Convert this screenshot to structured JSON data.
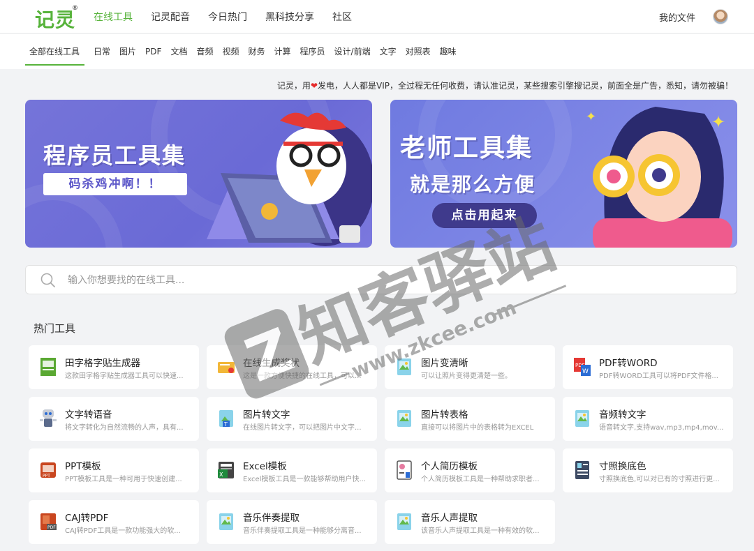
{
  "header": {
    "logo": "记灵",
    "logo_mark": "®",
    "nav": [
      {
        "label": "在线工具",
        "active": true
      },
      {
        "label": "记灵配音",
        "active": false
      },
      {
        "label": "今日热门",
        "active": false
      },
      {
        "label": "黑科技分享",
        "active": false
      },
      {
        "label": "社区",
        "active": false
      }
    ],
    "my_files": "我的文件"
  },
  "categories": [
    "全部在线工具",
    "日常",
    "图片",
    "PDF",
    "文档",
    "音频",
    "视频",
    "财务",
    "计算",
    "程序员",
    "设计/前端",
    "文字",
    "对照表",
    "趣味"
  ],
  "notice": {
    "before": "记灵，用",
    "heart": "❤",
    "after": "发电，人人都是VIP，全过程无任何收费，请认准记灵，某些搜索引擎搜记灵，前面全是广告，悉知，请勿被骗！"
  },
  "banners": {
    "left": {
      "title": "程序员工具集",
      "pill": "码杀鸡冲啊！！"
    },
    "right": {
      "title": "老师工具集",
      "subtitle": "就是那么方便",
      "pill": "点击用起来"
    }
  },
  "search": {
    "placeholder": "输入你想要找的在线工具..."
  },
  "section_title": "热门工具",
  "tools": [
    {
      "title": "田字格字贴生成器",
      "desc": "这款田字格字贴生成器工具可以快速...",
      "icon": "jiling-logo-icon"
    },
    {
      "title": "在线生成奖状",
      "desc": "这是一款方便快捷的在线工具，可以...",
      "icon": "certificate-icon"
    },
    {
      "title": "图片变清晰",
      "desc": "可以让照片变得更清楚一些。",
      "icon": "image-icon"
    },
    {
      "title": "PDF转WORD",
      "desc": "PDF转WORD工具可以将PDF文件格...",
      "icon": "pdf-word-icon"
    },
    {
      "title": "文字转语音",
      "desc": "将文字转化为自然流畅的人声，具有...",
      "icon": "robot-icon"
    },
    {
      "title": "图片转文字",
      "desc": "在线图片转文字，可以把图片中文字...",
      "icon": "image-text-icon"
    },
    {
      "title": "图片转表格",
      "desc": "直接可以将图片中的表格转为EXCEL",
      "icon": "image-icon"
    },
    {
      "title": "音频转文字",
      "desc": "语音转文字,支持wav,mp3,mp4,mov...",
      "icon": "image-icon"
    },
    {
      "title": "PPT模板",
      "desc": "PPT模板工具是一种可用于快速创建...",
      "icon": "ppt-icon"
    },
    {
      "title": "Excel模板",
      "desc": "Excel模板工具是一款能够帮助用户快...",
      "icon": "excel-icon"
    },
    {
      "title": "个人简历模板",
      "desc": "个人简历模板工具是一种帮助求职者...",
      "icon": "resume-icon"
    },
    {
      "title": "寸照换底色",
      "desc": "寸照换底色,可以对已有的寸照进行更...",
      "icon": "id-photo-icon"
    },
    {
      "title": "CAJ转PDF",
      "desc": "CAJ转PDF工具是一款功能强大的软...",
      "icon": "caj-pdf-icon"
    },
    {
      "title": "音乐伴奏提取",
      "desc": "音乐伴奏提取工具是一种能够分离音...",
      "icon": "image-icon"
    },
    {
      "title": "音乐人声提取",
      "desc": "该音乐人声提取工具是一种有效的软...",
      "icon": "image-icon"
    }
  ],
  "watermark": {
    "brand": "知客驿站",
    "url": "www.zkcee.com"
  },
  "colors": {
    "accent": "#57b33b",
    "banner_purple": "#6f6fd8",
    "heart": "#e62b2b"
  }
}
